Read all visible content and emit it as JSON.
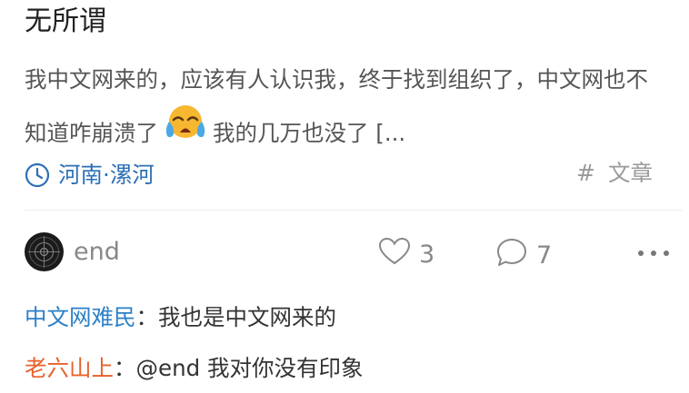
{
  "post": {
    "title": "无所谓",
    "body_before_emoji": "我中文网来的，应该有人认识我，终于找到组织了，中文网也不知道咋崩溃了",
    "body_after_emoji": "我的几万也没了 [...",
    "emoji_icon": "crying-face-icon",
    "location": "河南·漯河",
    "location_icon": "clock-icon",
    "category_hash": "#",
    "category": "文章"
  },
  "author": {
    "name": "end",
    "avatar_icon": "avatar-target-icon"
  },
  "stats": {
    "likes": "3",
    "comments": "7"
  },
  "comments": [
    {
      "user": "中文网难民",
      "separator": "：",
      "text": "我也是中文网来的",
      "user_color": "#2c80c8"
    },
    {
      "user": "老六山上",
      "separator": "：",
      "text": "@end 我对你没有印象",
      "user_color": "#e8612c"
    }
  ],
  "colors": {
    "link_blue": "#2c6fb5",
    "muted_gray": "#888888"
  }
}
